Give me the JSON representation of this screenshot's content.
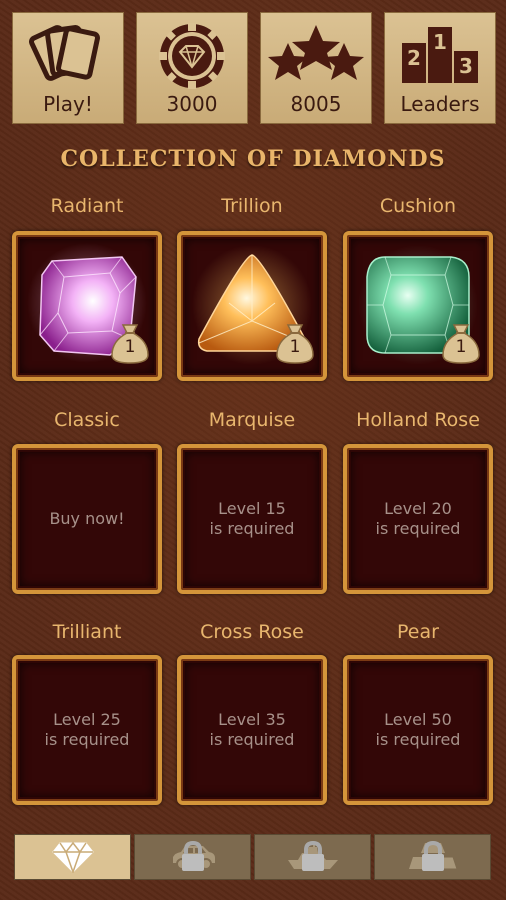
{
  "top_bar": {
    "play_label": "Play!",
    "chips_value": "3000",
    "stars_value": "8005",
    "leaders_label": "Leaders",
    "podium_numbers": [
      "2",
      "1",
      "3"
    ]
  },
  "title": "COLLECTION OF DIAMONDS",
  "diamonds": [
    {
      "name": "Radiant",
      "owned_count": "1",
      "color": "#d07ad8"
    },
    {
      "name": "Trillion",
      "owned_count": "1",
      "color": "#f0a040"
    },
    {
      "name": "Cushion",
      "owned_count": "1",
      "color": "#3fb07a"
    },
    {
      "name": "Classic",
      "message_line1": "Buy now!"
    },
    {
      "name": "Marquise",
      "message_line1": "Level 15",
      "message_line2": "is required"
    },
    {
      "name": "Holland Rose",
      "message_line1": "Level 20",
      "message_line2": "is required"
    },
    {
      "name": "Trilliant",
      "message_line1": "Level 25",
      "message_line2": "is required"
    },
    {
      "name": "Cross Rose",
      "message_line1": "Level 35",
      "message_line2": "is required"
    },
    {
      "name": "Pear",
      "message_line1": "Level 50",
      "message_line2": "is required"
    }
  ],
  "tabs": [
    {
      "icon": "diamond-icon",
      "active": true,
      "locked": false
    },
    {
      "icon": "car-icon",
      "active": false,
      "locked": true
    },
    {
      "icon": "yacht-icon",
      "active": false,
      "locked": true
    },
    {
      "icon": "gold-bars-icon",
      "active": false,
      "locked": true
    }
  ],
  "colors": {
    "accent": "#e8b66e",
    "frame": "#d4953a",
    "panel": "#dbc293"
  }
}
